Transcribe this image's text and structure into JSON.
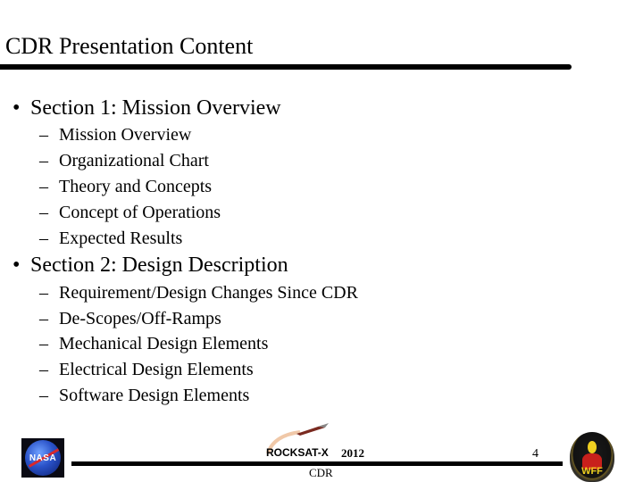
{
  "slide": {
    "title": "CDR Presentation Content",
    "sections": [
      {
        "bullet": "•",
        "label": "Section 1: Mission Overview",
        "items": [
          "Mission Overview",
          "Organizational Chart",
          "Theory and Concepts",
          "Concept of Operations",
          "Expected Results"
        ]
      },
      {
        "bullet": "•",
        "label": "Section 2: Design Description",
        "items": [
          "Requirement/Design Changes Since CDR",
          "De-Scopes/Off-Ramps",
          "Mechanical Design Elements",
          "Electrical Design Elements",
          "Software Design Elements"
        ]
      }
    ],
    "dash": "–"
  },
  "footer": {
    "left_logo": "NASA",
    "center_logo": "ROCKSAT-X",
    "year": "2012",
    "subtitle": "CDR",
    "page_number": "4",
    "right_logo": "WFF"
  }
}
